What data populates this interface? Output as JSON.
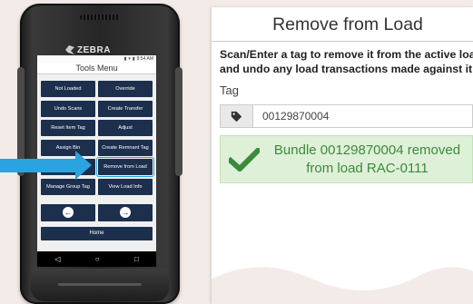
{
  "device": {
    "brand": "ZEBRA",
    "status_time": "8:54 AM",
    "screen_title": "Tools Menu",
    "menu": [
      {
        "label": "Not Loaded"
      },
      {
        "label": "Override"
      },
      {
        "label": "Undo Scans"
      },
      {
        "label": "Create Transfer"
      },
      {
        "label": "Reset Item Tag"
      },
      {
        "label": "Adjust"
      },
      {
        "label": "Assign Bin"
      },
      {
        "label": "Create Remnant Tag"
      },
      {
        "label": ""
      },
      {
        "label": "Remove from Load",
        "highlighted": true
      },
      {
        "label": "Manage Group Tag"
      },
      {
        "label": "View Load Info"
      }
    ],
    "back_icon": "arrow-left-circle-icon",
    "forward_icon": "arrow-right-circle-icon",
    "home_label": "Home",
    "highlight_color": "#2aa3e0",
    "button_color": "#1c2f4d"
  },
  "panel": {
    "title": "Remove from Load",
    "description_line1": "Scan/Enter a tag to remove it from the active load",
    "description_line2": "and undo any load transactions made against it",
    "tag_label": "Tag",
    "tag_icon": "tag-icon",
    "tag_value": "00129870004",
    "success_line1": "Bundle 00129870004 removed",
    "success_line2": "from load RAC-0111",
    "success_color": "#3c8a3c",
    "success_bg": "#dff0d8"
  }
}
